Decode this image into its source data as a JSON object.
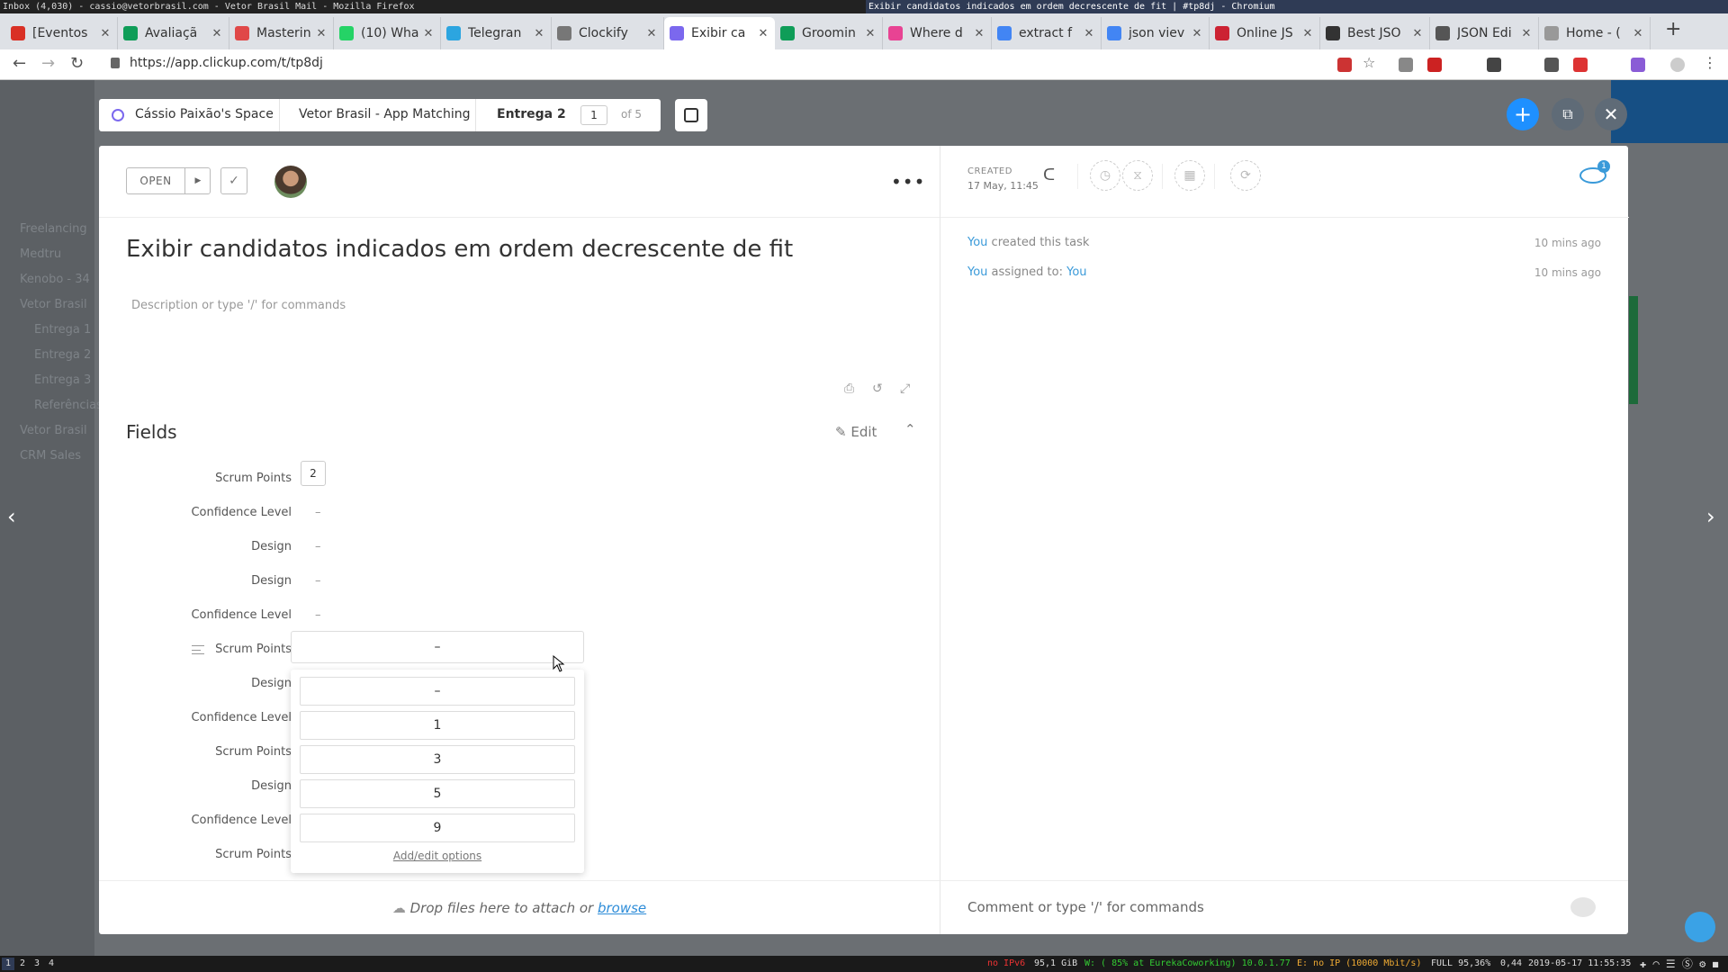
{
  "os_bar": {
    "left_title": "Inbox (4,030) - cassio@vetorbrasil.com - Vetor Brasil Mail - Mozilla Firefox",
    "right_title": "Exibir candidatos indicados em ordem decrescente de fit | #tp8dj - Chromium"
  },
  "browser": {
    "tabs": [
      {
        "label": "[Eventos",
        "icon": "gmail-icon",
        "color": "#d93025"
      },
      {
        "label": "Avaliaçã",
        "icon": "sheet-icon",
        "color": "#0f9d58"
      },
      {
        "label": "Masterin",
        "icon": "coursera-icon",
        "color": "#e04848"
      },
      {
        "label": "(10) Wha",
        "icon": "whatsapp-icon",
        "color": "#25d366"
      },
      {
        "label": "Telegran",
        "icon": "telegram-icon",
        "color": "#2ca5e0"
      },
      {
        "label": "Clockify",
        "icon": "clockify-icon",
        "color": "#777777"
      },
      {
        "label": "Exibir ca",
        "icon": "clickup-icon",
        "color": "#7b68ee",
        "active": true
      },
      {
        "label": "Groomin",
        "icon": "sheets-icon",
        "color": "#0f9d58"
      },
      {
        "label": "Where d",
        "icon": "clickup-icon",
        "color": "#e84393"
      },
      {
        "label": "extract f",
        "icon": "google-icon",
        "color": "#4285f4"
      },
      {
        "label": "json viev",
        "icon": "google-icon",
        "color": "#4285f4"
      },
      {
        "label": "Online JS",
        "icon": "opera-icon",
        "color": "#cc2233"
      },
      {
        "label": "Best JSO",
        "icon": "codebeautify-icon",
        "color": "#333333"
      },
      {
        "label": "JSON Edi",
        "icon": "braces-icon",
        "color": "#555555"
      },
      {
        "label": "Home - (",
        "icon": "doc-icon",
        "color": "#999999"
      }
    ],
    "url": "https://app.clickup.com/t/tp8dj"
  },
  "breadcrumb": {
    "space": "Cássio Paixão's Space",
    "list": "Vetor Brasil - App Matching",
    "current": "Entrega 2",
    "page": "1",
    "of": "of 5"
  },
  "task": {
    "status": "OPEN",
    "title": "Exibir candidatos indicados em ordem decrescente de fit",
    "description_placeholder": "Description or type '/' for commands",
    "fields_heading": "Fields",
    "edit_label": "Edit",
    "fields": [
      {
        "label": "Scrum Points",
        "value": "2"
      },
      {
        "label": "Confidence Level",
        "value": "–"
      },
      {
        "label": "Design",
        "value": "–"
      },
      {
        "label": "Design",
        "value": "–"
      },
      {
        "label": "Confidence Level",
        "value": "–"
      },
      {
        "label": "Scrum Points",
        "value": "–"
      },
      {
        "label": "Design",
        "value": ""
      },
      {
        "label": "Confidence Level",
        "value": ""
      },
      {
        "label": "Scrum Points",
        "value": ""
      },
      {
        "label": "Design",
        "value": ""
      },
      {
        "label": "Confidence Level",
        "value": ""
      },
      {
        "label": "Scrum Points",
        "value": ""
      }
    ],
    "select_value": "–",
    "dropdown_options": [
      "–",
      "1",
      "3",
      "5",
      "9"
    ],
    "add_edit_options": "Add/edit options",
    "drop_files": "Drop files here to attach or",
    "browse": "browse"
  },
  "sidebar": {
    "created_label": "CREATED",
    "created_value": "17 May, 11:45",
    "watchers_count": "1",
    "activity": [
      {
        "user": "You",
        "text": " created this task",
        "time": "10 mins ago"
      },
      {
        "user": "You",
        "text": " assigned to: ",
        "target": "You",
        "time": "10 mins ago"
      }
    ],
    "comment_placeholder": "Comment or type '/' for commands"
  },
  "background_sidebar": [
    "Freelancing",
    "Medtru",
    "Kenobo - 34",
    "Vetor Brasil",
    "Entrega 1",
    "Entrega 2",
    "Entrega 3",
    "Referências",
    "Vetor Brasil",
    "CRM Sales"
  ],
  "status_bar": {
    "workspaces": [
      "1",
      "2",
      "3",
      "4"
    ],
    "ipv6": "no IPv6",
    "disk": "95,1 GiB",
    "wifi": "W: ( 85% at EurekaCoworking) 10.0.1.77",
    "eth": "E: no IP (10000 Mbit/s)",
    "battery": "FULL 95,36%",
    "load": "0,44",
    "datetime": "2019-05-17 11:55:35"
  },
  "colors": {
    "accent": "#3a9ad9",
    "fab": "#1e90ff"
  }
}
